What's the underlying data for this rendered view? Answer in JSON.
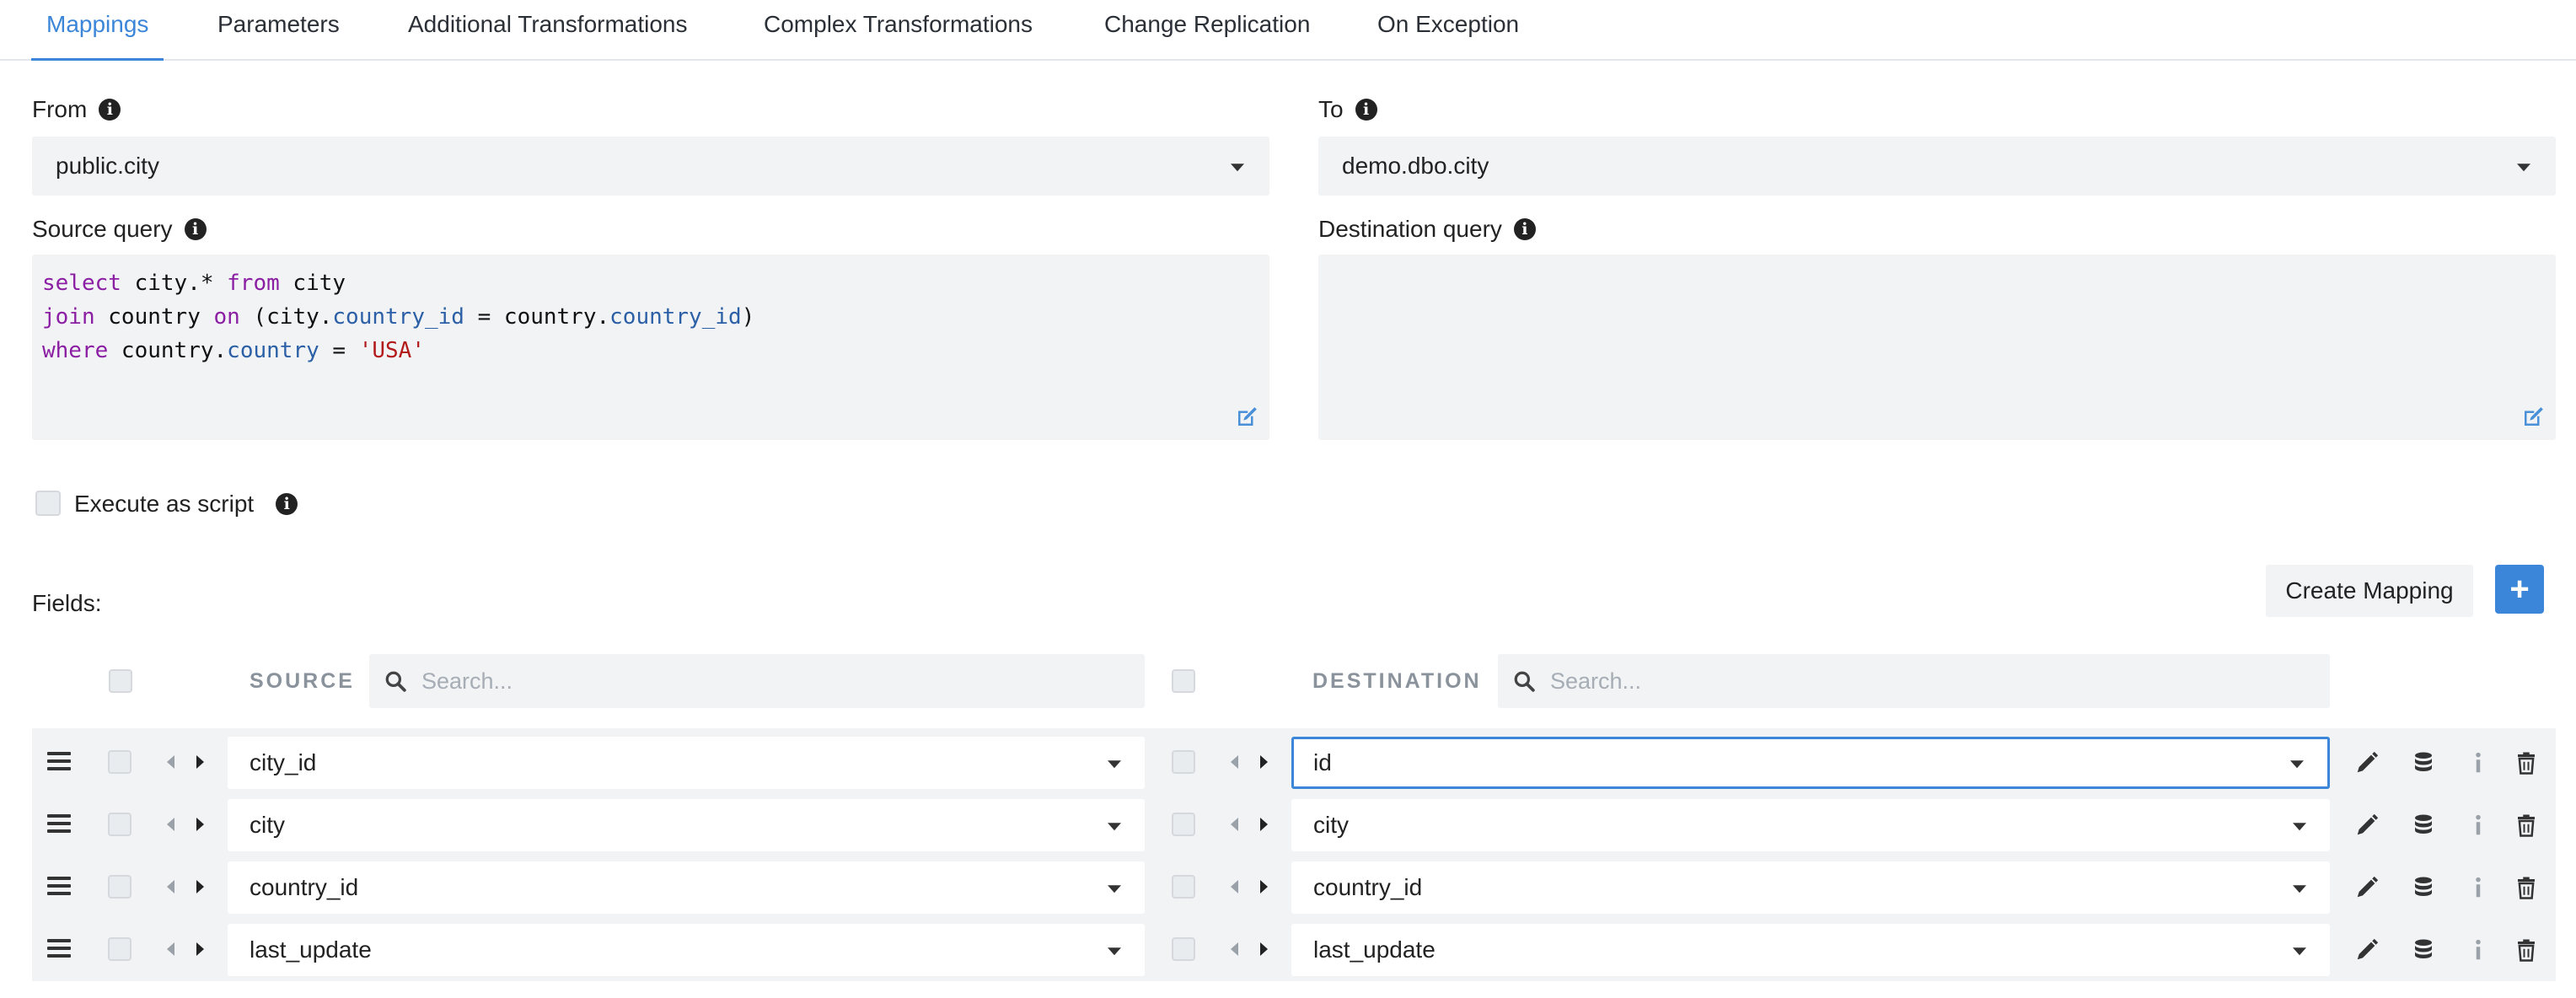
{
  "tabs": [
    {
      "label": "Mappings",
      "active": true
    },
    {
      "label": "Parameters"
    },
    {
      "label": "Additional Transformations"
    },
    {
      "label": "Complex Transformations"
    },
    {
      "label": "Change Replication"
    },
    {
      "label": "On Exception"
    }
  ],
  "from": {
    "label": "From",
    "value": "public.city"
  },
  "to": {
    "label": "To",
    "value": "demo.dbo.city"
  },
  "source_query": {
    "label": "Source query",
    "line1": {
      "kw1": "select",
      "t1": " city.* ",
      "kw2": "from",
      "t2": " city"
    },
    "line2": {
      "kw1": "join",
      "t1": " country ",
      "kw2": "on",
      "t2": " (city.",
      "p1": "country_id",
      "t3": " = country.",
      "p2": "country_id",
      "t4": ")"
    },
    "line3": {
      "kw1": "where",
      "t1": " country.",
      "p1": "country",
      "t2": " = ",
      "s1": "'USA'"
    }
  },
  "destination_query": {
    "label": "Destination query"
  },
  "execute_as_script": {
    "label": "Execute as script",
    "checked": false
  },
  "fields": {
    "label": "Fields:",
    "create_mapping_label": "Create Mapping",
    "add_label": "+",
    "source_header": "SOURCE",
    "destination_header": "DESTINATION",
    "search_placeholder": "Search...",
    "rows": [
      {
        "source": "city_id",
        "destination": "id"
      },
      {
        "source": "city",
        "destination": "city"
      },
      {
        "source": "country_id",
        "destination": "country_id"
      },
      {
        "source": "last_update",
        "destination": "last_update"
      }
    ]
  },
  "colors": {
    "accent": "#3b86d8",
    "panel": "#f2f3f5"
  },
  "icons": [
    "info-icon",
    "edit-icon",
    "search-icon",
    "drag-handle-icon",
    "pencil-icon",
    "database-icon",
    "info-small-icon",
    "trash-icon",
    "caret-down-icon"
  ]
}
